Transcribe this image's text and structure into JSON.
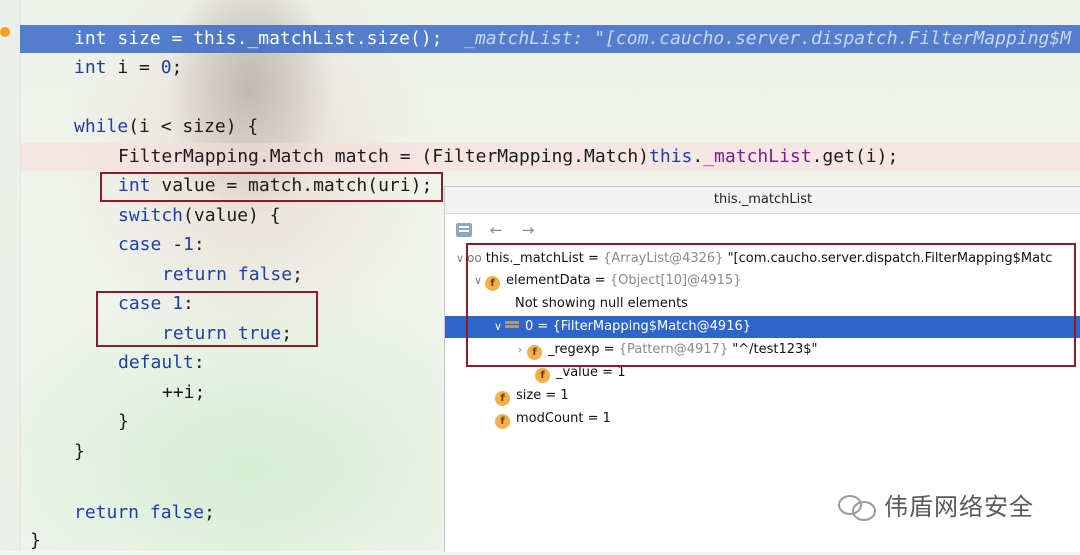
{
  "editor": {
    "lines": [
      {
        "tokens": [
          {
            "t": "int",
            "c": "kw-light"
          },
          {
            "t": " size = "
          },
          {
            "t": "this"
          },
          {
            "t": "._matchList"
          },
          {
            "t": ".size();  "
          },
          {
            "t": "_matchList: \"[com.caucho.server.dispatch.FilterMapping$M",
            "c": "hint"
          }
        ]
      },
      {
        "tokens": [
          {
            "t": "int",
            "c": "kw"
          },
          {
            "t": " i = "
          },
          {
            "t": "0",
            "c": "kw"
          },
          {
            "t": ";"
          }
        ]
      },
      {
        "tokens": [
          {
            "t": "while",
            "c": "kw"
          },
          {
            "t": "(i < size) {"
          }
        ]
      },
      {
        "tokens": [
          {
            "t": "FilterMapping.Match match = (FilterMapping.Match)"
          },
          {
            "t": "this",
            "c": "kw"
          },
          {
            "t": "."
          },
          {
            "t": "_matchList",
            "c": "field"
          },
          {
            "t": ".get(i);"
          }
        ]
      },
      {
        "tokens": [
          {
            "t": "int",
            "c": "kw"
          },
          {
            "t": " value = match.match(uri);"
          }
        ]
      },
      {
        "tokens": [
          {
            "t": "switch",
            "c": "kw"
          },
          {
            "t": "(value) {"
          }
        ]
      },
      {
        "tokens": [
          {
            "t": "case",
            "c": "kw"
          },
          {
            "t": " -"
          },
          {
            "t": "1",
            "c": "kw"
          },
          {
            "t": ":"
          }
        ]
      },
      {
        "tokens": [
          {
            "t": "return",
            "c": "kw"
          },
          {
            "t": " "
          },
          {
            "t": "false",
            "c": "kw"
          },
          {
            "t": ";"
          }
        ]
      },
      {
        "tokens": [
          {
            "t": "case",
            "c": "kw"
          },
          {
            "t": " "
          },
          {
            "t": "1",
            "c": "kw"
          },
          {
            "t": ":"
          }
        ]
      },
      {
        "tokens": [
          {
            "t": "return",
            "c": "kw"
          },
          {
            "t": " "
          },
          {
            "t": "true",
            "c": "kw"
          },
          {
            "t": ";"
          }
        ]
      },
      {
        "tokens": [
          {
            "t": "default",
            "c": "kw"
          },
          {
            "t": ":"
          }
        ]
      },
      {
        "tokens": [
          {
            "t": "++i;"
          }
        ]
      },
      {
        "tokens": [
          {
            "t": "}"
          }
        ]
      },
      {
        "tokens": [
          {
            "t": "}"
          }
        ]
      },
      {
        "tokens": [
          {
            "t": "return",
            "c": "kw"
          },
          {
            "t": " "
          },
          {
            "t": "false",
            "c": "kw"
          },
          {
            "t": ";"
          }
        ]
      },
      {
        "tokens": [
          {
            "t": "}"
          }
        ]
      }
    ]
  },
  "popup": {
    "title": "this._matchList",
    "toolbar": {
      "back_icon": "arrow-left-icon",
      "forward_icon": "arrow-right-icon",
      "view_icon": "view-tree-icon"
    },
    "nodes": [
      {
        "name": "this._matchList",
        "eq": " = ",
        "type": "{ArrayList@4326}",
        "value": " \"[com.caucho.server.dispatch.FilterMapping$Matc"
      },
      {
        "name": "elementData",
        "eq": " = ",
        "type": "{Object[10]@4915}",
        "value": ""
      },
      {
        "text": "Not showing null elements"
      },
      {
        "name": "0",
        "eq": " = ",
        "type": "{FilterMapping$Match@4916}",
        "value": ""
      },
      {
        "name": "_regexp",
        "eq": " = ",
        "type": "{Pattern@4917}",
        "value": " \"^/test123$\""
      },
      {
        "name": "_value",
        "eq": " = ",
        "type": "",
        "value": "1"
      },
      {
        "name": "size",
        "eq": " = ",
        "type": "",
        "value": "1"
      },
      {
        "name": "modCount",
        "eq": " = ",
        "type": "",
        "value": "1"
      }
    ]
  },
  "watermark": {
    "text": "伟盾网络安全"
  },
  "colors": {
    "execution_line": "#386ac6",
    "breakpoint": "#f2a11f",
    "selection": "#2f65ca",
    "highlight_box": "#8a1d2a"
  }
}
